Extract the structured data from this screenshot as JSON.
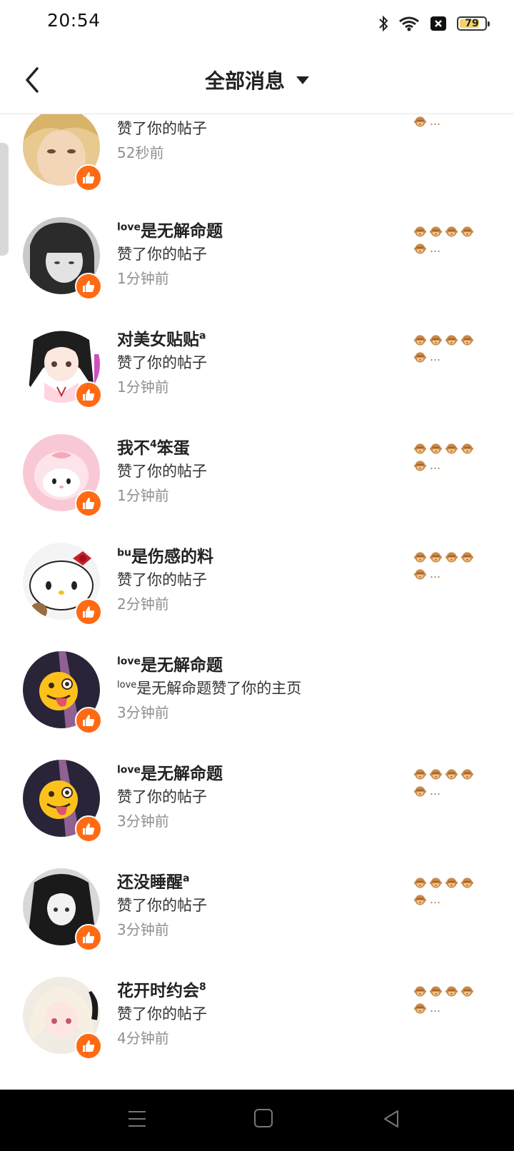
{
  "status_bar": {
    "time": "20:54",
    "battery": "79",
    "battery_level": 0.79
  },
  "header": {
    "title": "全部消息"
  },
  "notifications": [
    {
      "name": "",
      "name_suffix": "",
      "action": "赞了你的帖子",
      "time": "52秒前",
      "preview_icons": 0,
      "preview_tail": "…",
      "preview_extra": "🙊",
      "avatar": "blonde-girl"
    },
    {
      "name": "是无解命题",
      "name_prefix": "love",
      "name_suffix": "",
      "action": "赞了你的帖子",
      "time": "1分钟前",
      "preview_icons": 5,
      "preview_tail": "…",
      "avatar": "dark-hair-girl"
    },
    {
      "name": "对美女贴贴",
      "name_prefix": "",
      "name_suffix": "a",
      "action": "赞了你的帖子",
      "time": "1分钟前",
      "preview_icons": 5,
      "preview_tail": "…",
      "avatar": "anime-twin-tails"
    },
    {
      "name": "我不",
      "name_prefix": "",
      "name_mid_sup": "4",
      "name_after": "笨蛋",
      "name_suffix": "",
      "action": "赞了你的帖子",
      "time": "1分钟前",
      "preview_icons": 5,
      "preview_tail": "…",
      "avatar": "my-melody"
    },
    {
      "name": "是伤感的料",
      "name_prefix": "bu",
      "name_suffix": "",
      "action": "赞了你的帖子",
      "time": "2分钟前",
      "preview_icons": 5,
      "preview_tail": "…",
      "avatar": "hello-kitty"
    },
    {
      "name": "是无解命题",
      "name_prefix": "love",
      "name_suffix": "",
      "action_prefix": "love",
      "action": "是无解命题赞了你的主页",
      "time": "3分钟前",
      "preview_icons": 0,
      "preview_tail": "",
      "avatar": "tongue-emoji"
    },
    {
      "name": "是无解命题",
      "name_prefix": "love",
      "name_suffix": "",
      "action": "赞了你的帖子",
      "time": "3分钟前",
      "preview_icons": 5,
      "preview_tail": "…",
      "avatar": "tongue-emoji"
    },
    {
      "name": "还没睡醒",
      "name_prefix": "",
      "name_suffix": "a",
      "action": "赞了你的帖子",
      "time": "3分钟前",
      "preview_icons": 5,
      "preview_tail": "…",
      "avatar": "bw-anime-girl"
    },
    {
      "name": "花开时约会",
      "name_prefix": "",
      "name_suffix": "8",
      "action": "赞了你的帖子",
      "time": "4分钟前",
      "preview_icons": 5,
      "preview_tail": "…",
      "avatar": "white-hair-anime"
    }
  ],
  "colors": {
    "like_badge": "#ff6a13",
    "time_text": "#8f8f8f",
    "nav_bar": "#000000"
  },
  "icons": {
    "back": "chevron-left-icon",
    "dropdown": "triangle-down-icon",
    "like": "thumbs-up-icon",
    "preview": "see-no-evil-monkey-icon"
  }
}
